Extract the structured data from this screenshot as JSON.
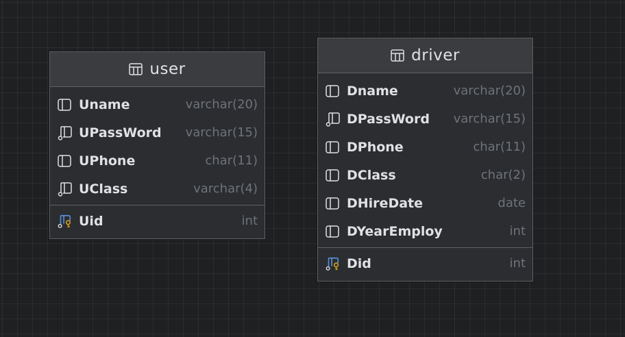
{
  "tables": [
    {
      "name": "user",
      "columns": [
        {
          "name": "Uname",
          "type": "varchar(20)",
          "icon": "column-icon"
        },
        {
          "name": "UPassWord",
          "type": "varchar(15)",
          "icon": "nullable-column-icon"
        },
        {
          "name": "UPhone",
          "type": "char(11)",
          "icon": "column-icon"
        },
        {
          "name": "UClass",
          "type": "varchar(4)",
          "icon": "nullable-column-icon"
        }
      ],
      "primary_keys": [
        {
          "name": "Uid",
          "type": "int",
          "icon": "primary-key-column-icon"
        }
      ]
    },
    {
      "name": "driver",
      "columns": [
        {
          "name": "Dname",
          "type": "varchar(20)",
          "icon": "column-icon"
        },
        {
          "name": "DPassWord",
          "type": "varchar(15)",
          "icon": "nullable-column-icon"
        },
        {
          "name": "DPhone",
          "type": "char(11)",
          "icon": "column-icon"
        },
        {
          "name": "DClass",
          "type": "char(2)",
          "icon": "column-icon"
        },
        {
          "name": "DHireDate",
          "type": "date",
          "icon": "column-icon"
        },
        {
          "name": "DYearEmploy",
          "type": "int",
          "icon": "column-icon"
        }
      ],
      "primary_keys": [
        {
          "name": "Did",
          "type": "int",
          "icon": "primary-key-column-icon"
        }
      ]
    }
  ],
  "colors": {
    "canvas": "#1f2022",
    "card": "#2b2d30",
    "header": "#3b3c3f",
    "border": "#5e6166",
    "name_text": "#dfe1e5",
    "type_text": "#6f737a",
    "key_blue": "#5a8fd6",
    "key_gold": "#d4a017"
  }
}
